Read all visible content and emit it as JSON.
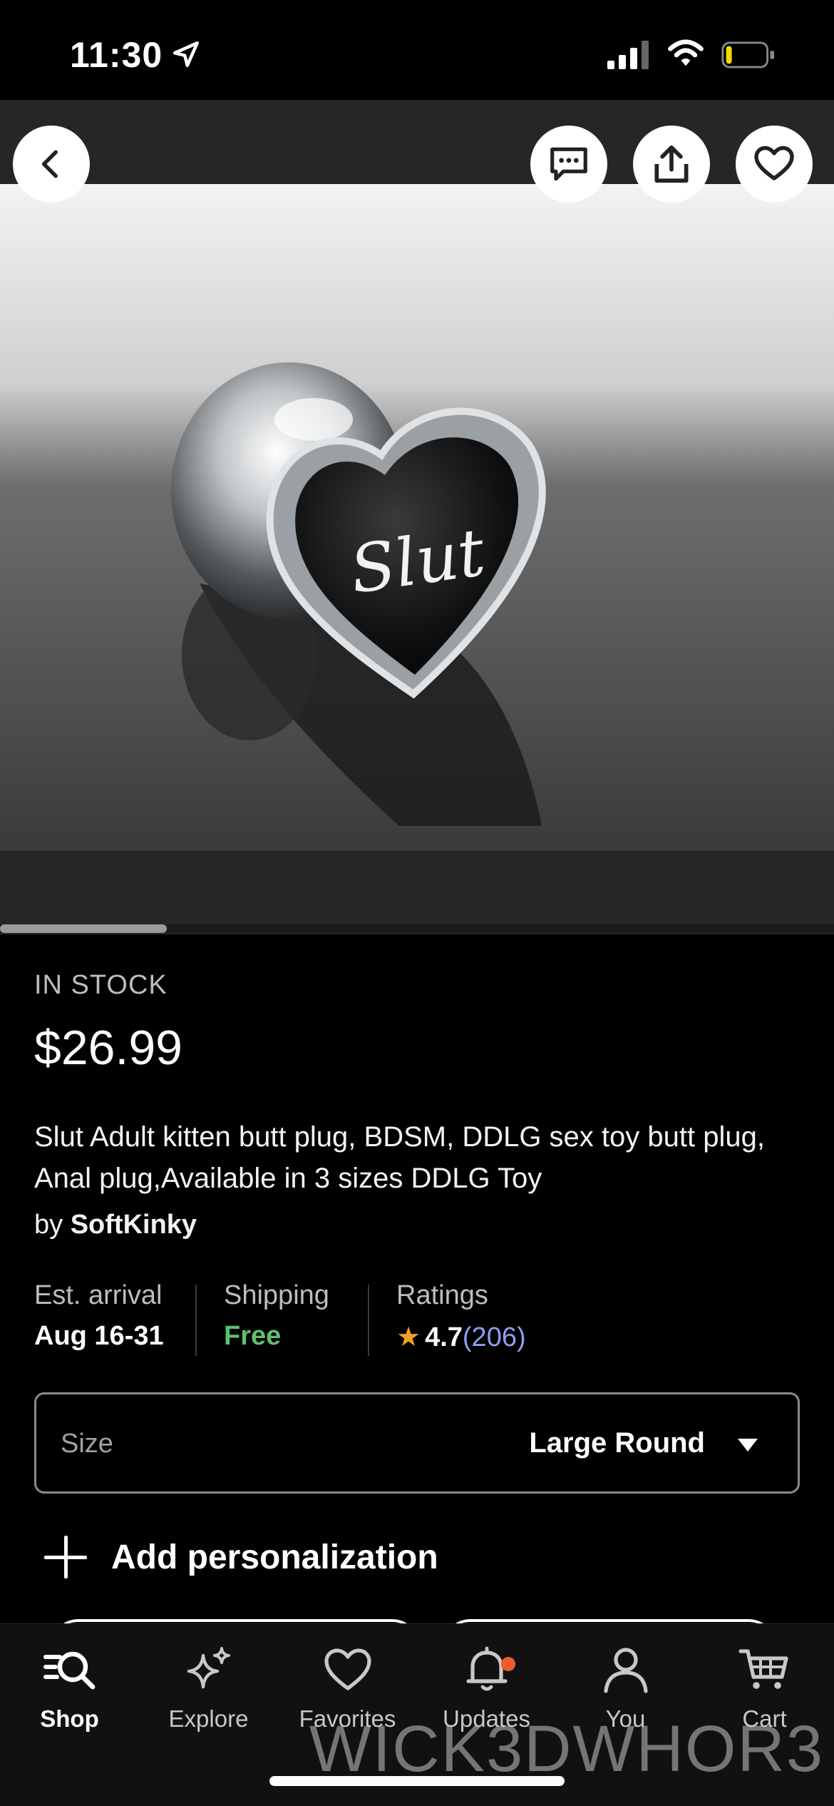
{
  "status_bar": {
    "time": "11:30",
    "battery_level": 0.15
  },
  "product": {
    "stock": "IN STOCK",
    "price": "$26.99",
    "title": "Slut Adult kitten butt plug, BDSM, DDLG sex toy butt plug, Anal plug,Available in 3 sizes DDLG Toy",
    "by_prefix": "by",
    "shop": "SoftKinky",
    "image_text": "Slut"
  },
  "info": {
    "arrival_label": "Est. arrival",
    "arrival_value": "Aug 16-31",
    "shipping_label": "Shipping",
    "shipping_value": "Free",
    "ratings_label": "Ratings",
    "rating_value": "4.7",
    "rating_count": "(206)"
  },
  "size": {
    "label": "Size",
    "value": "Large Round"
  },
  "personalize": {
    "label": "Add personalization"
  },
  "tabs": [
    {
      "label": "Shop",
      "icon": "shop-search-icon"
    },
    {
      "label": "Explore",
      "icon": "sparkle-icon"
    },
    {
      "label": "Favorites",
      "icon": "heart-icon"
    },
    {
      "label": "Updates",
      "icon": "bell-icon"
    },
    {
      "label": "You",
      "icon": "person-icon"
    },
    {
      "label": "Cart",
      "icon": "cart-icon"
    }
  ],
  "watermark": "WICK3DWHOR3",
  "colors": {
    "free": "#5fbf6f",
    "rating_count": "#8f9ef0",
    "star": "#f4a020",
    "badge": "#f05a2a"
  }
}
